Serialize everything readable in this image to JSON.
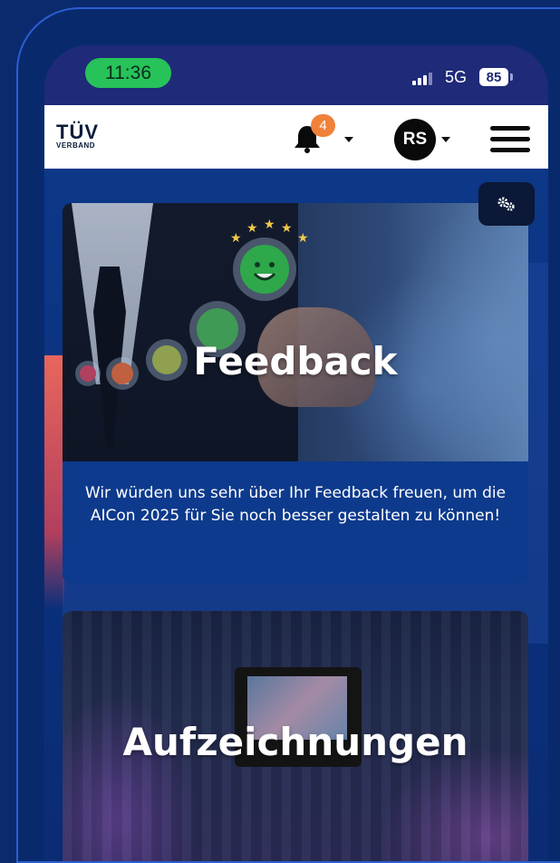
{
  "status_bar": {
    "time": "11:36",
    "network": "5G",
    "battery": "85"
  },
  "header": {
    "logo_main": "TÜV",
    "logo_sub": "VERBAND",
    "notification_count": "4",
    "avatar_initials": "RS"
  },
  "feedback_card": {
    "title": "Feedback",
    "text": "Wir würden uns sehr über Ihr Feedback freuen, um die AICon 2025 für Sie noch besser gestalten zu können!"
  },
  "recordings_card": {
    "title": "Aufzeichnungen"
  },
  "icons": {
    "settings": "gears-icon",
    "notifications": "bell-icon",
    "menu": "hamburger-menu-icon"
  },
  "colors": {
    "time_pill": "#27c25a",
    "badge": "#f0813a",
    "background": "#0b2a6e"
  }
}
